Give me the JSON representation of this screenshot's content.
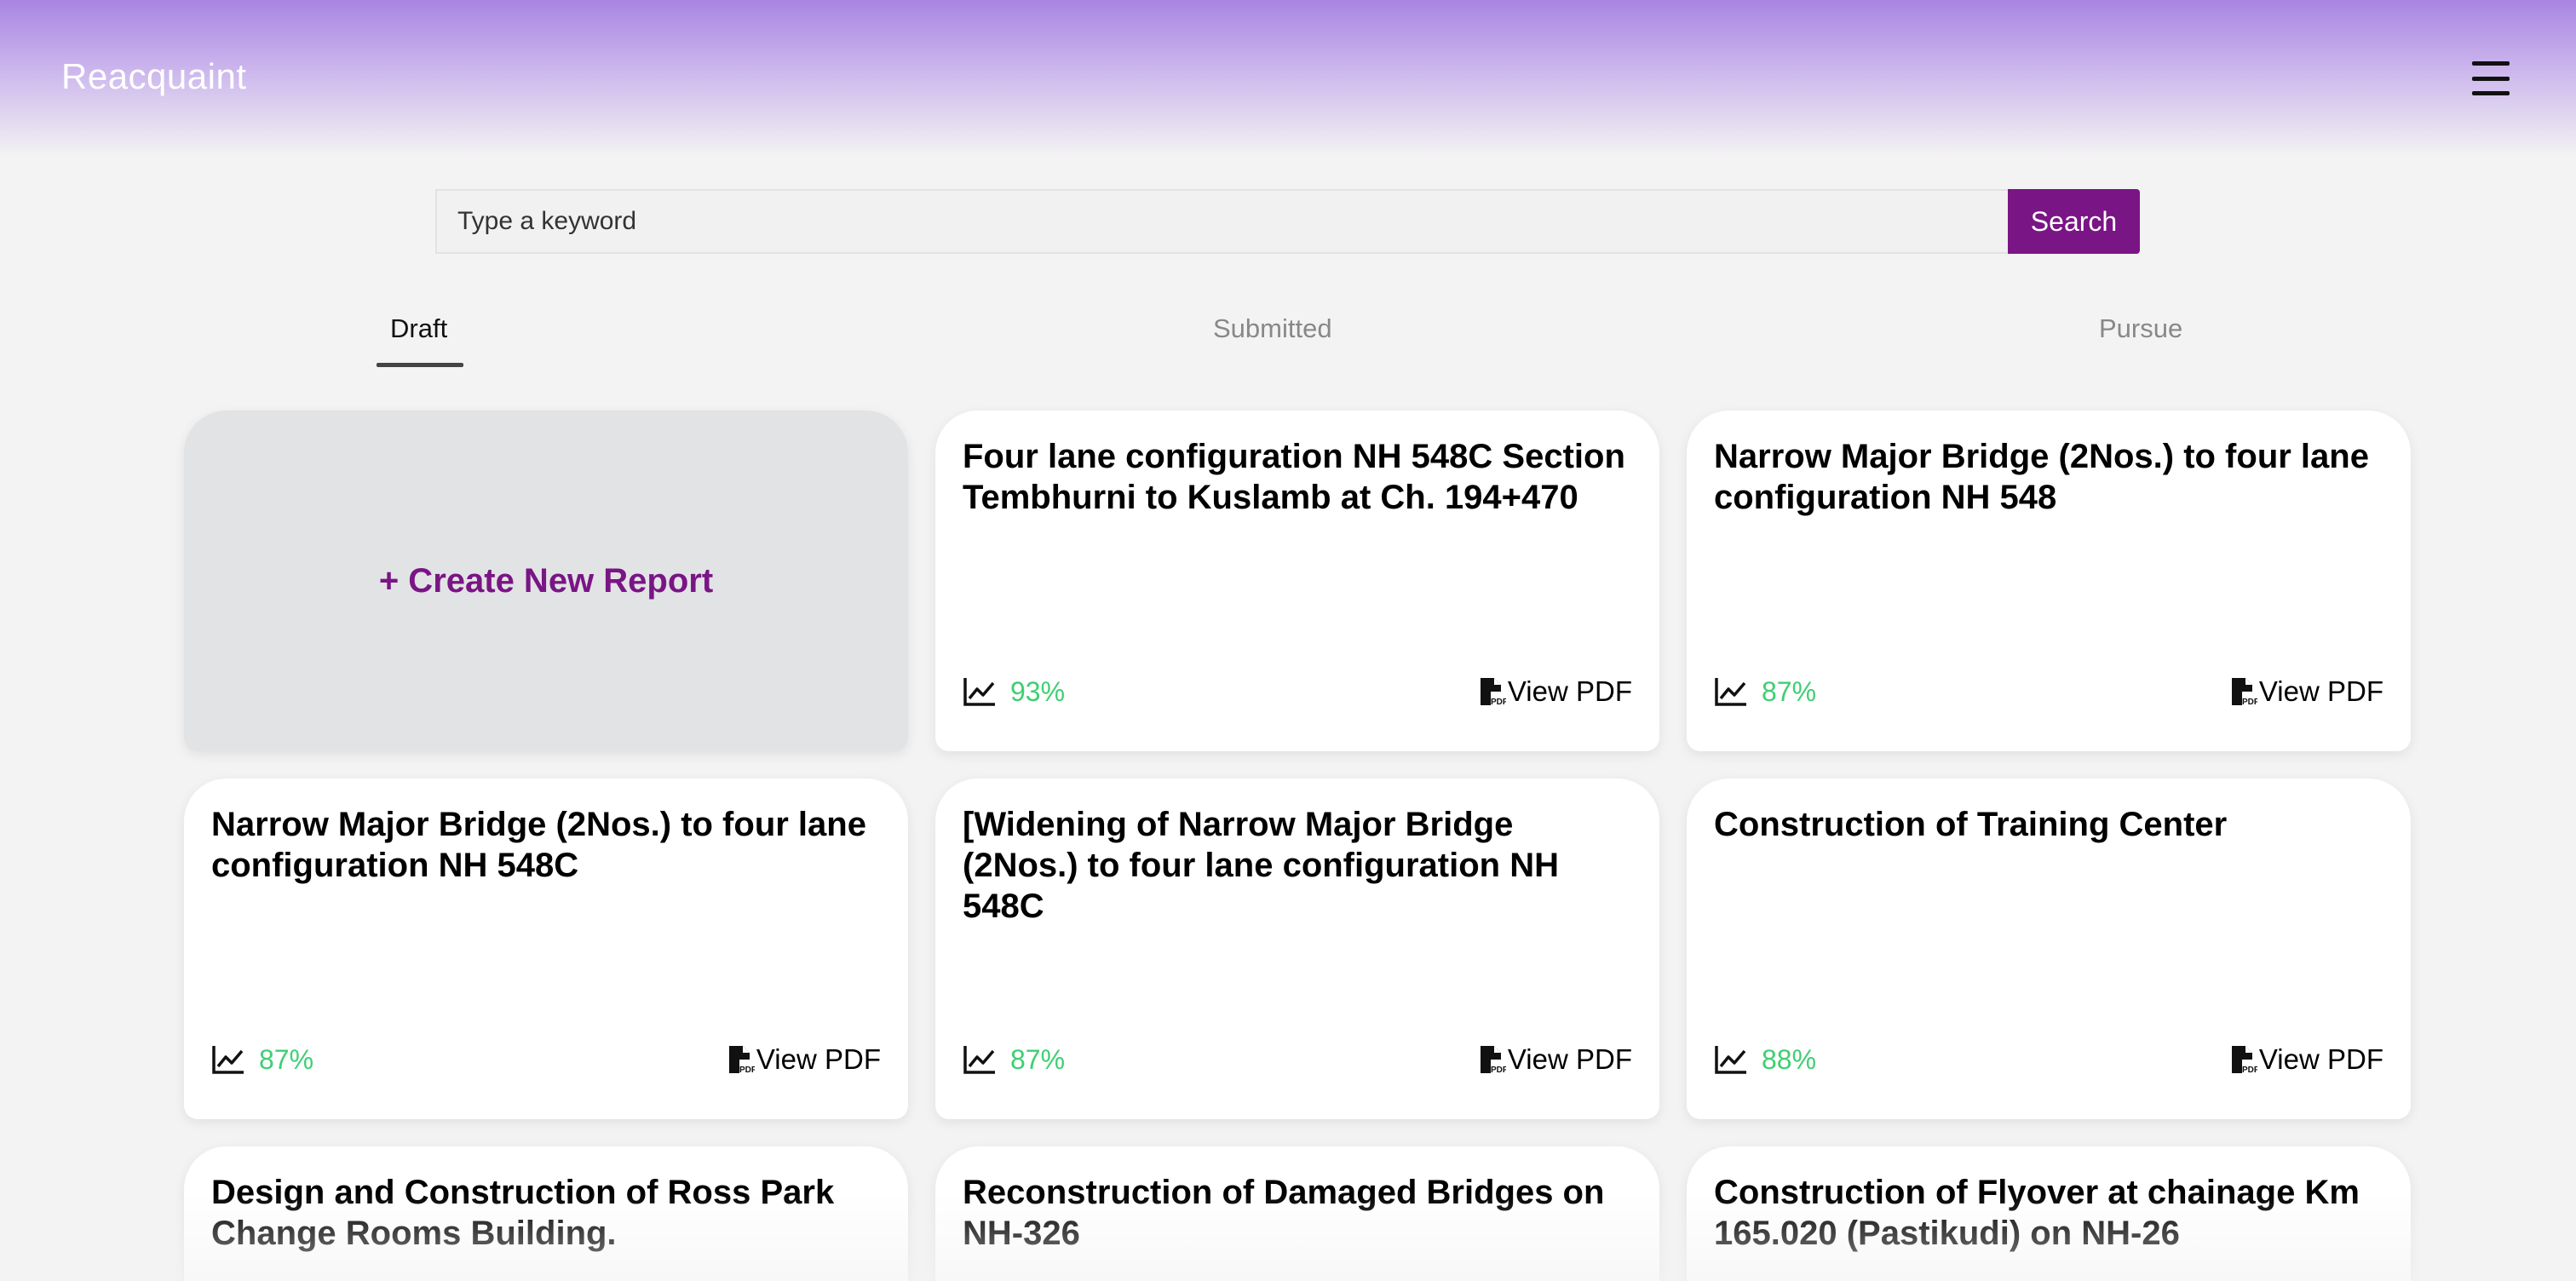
{
  "header": {
    "brand": "Reacquaint",
    "menu_icon": "hamburger-icon"
  },
  "search": {
    "placeholder": "Type a keyword",
    "value": "",
    "button_label": "Search"
  },
  "tabs": [
    {
      "label": "Draft",
      "active": true
    },
    {
      "label": "Submitted",
      "active": false
    },
    {
      "label": "Pursue",
      "active": false
    }
  ],
  "create_card": {
    "label": "+ Create New Report"
  },
  "reports": [
    {
      "title": "Four lane configuration NH 548C Section Tembhurni to Kuslamb at Ch. 194+470",
      "score": "93%",
      "pdf_label": "View PDF"
    },
    {
      "title": "Narrow Major Bridge (2Nos.) to four lane configuration NH 548",
      "score": "87%",
      "pdf_label": "View PDF"
    },
    {
      "title": "Narrow Major Bridge (2Nos.) to four lane configuration NH 548C",
      "score": "87%",
      "pdf_label": "View PDF"
    },
    {
      "title": "[Widening of Narrow Major Bridge (2Nos.) to four lane configuration NH 548C",
      "score": "87%",
      "pdf_label": "View PDF"
    },
    {
      "title": "Construction of Training Center",
      "score": "88%",
      "pdf_label": "View PDF"
    },
    {
      "title": "Design and Construction of Ross Park Change Rooms Building.",
      "score": "",
      "pdf_label": ""
    },
    {
      "title": "Reconstruction of Damaged Bridges on NH-326",
      "score": "",
      "pdf_label": ""
    },
    {
      "title": "Construction of Flyover at chainage Km 165.020 (Pastikudi) on NH-26",
      "score": "",
      "pdf_label": ""
    }
  ],
  "colors": {
    "accent": "#7a1585",
    "score": "#3ecf72",
    "header_top": "#a985e2"
  }
}
